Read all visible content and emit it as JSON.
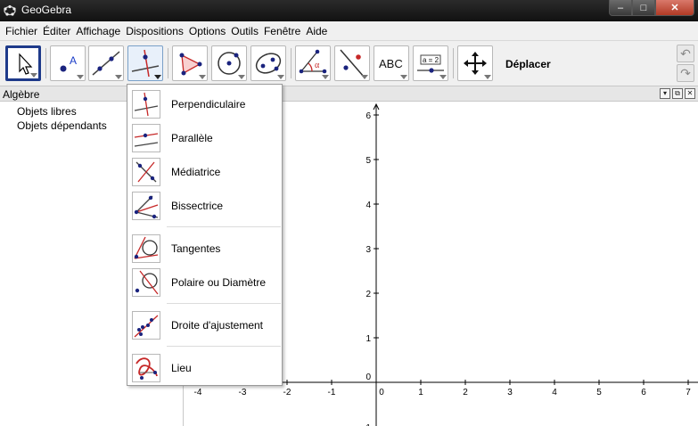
{
  "window": {
    "title": "GeoGebra",
    "min_glyph": "–",
    "max_glyph": "□",
    "close_glyph": "✕"
  },
  "menu": [
    "Fichier",
    "Éditer",
    "Affichage",
    "Dispositions",
    "Options",
    "Outils",
    "Fenêtre",
    "Aide"
  ],
  "toolbar": {
    "tools": [
      {
        "name": "move-tool-button",
        "icon": "pointer-icon"
      },
      {
        "name": "point-tool-button",
        "icon": "point-icon"
      },
      {
        "name": "line-tool-button",
        "icon": "line-icon"
      },
      {
        "name": "perpendicular-tool-button",
        "icon": "perpendicular-icon"
      },
      {
        "name": "polygon-tool-button",
        "icon": "polygon-icon"
      },
      {
        "name": "circle-tool-button",
        "icon": "circle-icon"
      },
      {
        "name": "ellipse-tool-button",
        "icon": "ellipse-icon"
      },
      {
        "name": "angle-tool-button",
        "icon": "angle-icon"
      },
      {
        "name": "reflect-tool-button",
        "icon": "reflect-icon"
      },
      {
        "name": "text-tool-button",
        "icon": "text-icon",
        "text": "ABC"
      },
      {
        "name": "slider-tool-button",
        "icon": "slider-icon",
        "text": "a = 2"
      },
      {
        "name": "move-view-tool-button",
        "icon": "move-view-icon"
      }
    ],
    "selected_tool_name": "Déplacer",
    "undo_glyph": "↶",
    "redo_glyph": "↷"
  },
  "algebra": {
    "header": "Algèbre",
    "items": [
      "Objets libres",
      "Objets dépendants"
    ]
  },
  "graphics": {
    "btn_menu": "▾",
    "btn_restore": "⧉",
    "btn_close": "✕",
    "x_ticks": [
      "-4",
      "-3",
      "-2",
      "-1",
      "0",
      "1",
      "2",
      "3",
      "4",
      "5",
      "6",
      "7"
    ],
    "y_ticks": [
      "1",
      "2",
      "3",
      "4",
      "5",
      "6"
    ],
    "y_zero": "0",
    "y_neg": "-1"
  },
  "dropdown": {
    "items": [
      {
        "label": "Perpendiculaire",
        "icon": "perpendicular-icon"
      },
      {
        "label": "Parallèle",
        "icon": "parallel-icon"
      },
      {
        "label": "Médiatrice",
        "icon": "perpendicular-bisector-icon"
      },
      {
        "label": "Bissectrice",
        "icon": "angle-bisector-icon"
      },
      {
        "label": "Tangentes",
        "icon": "tangent-icon"
      },
      {
        "label": "Polaire ou Diamètre",
        "icon": "polar-icon"
      },
      {
        "label": "Droite d'ajustement",
        "icon": "best-fit-line-icon"
      },
      {
        "label": "Lieu",
        "icon": "locus-icon"
      }
    ]
  },
  "colors": {
    "point": "#1a237e",
    "line": "#c62828",
    "selected_border": "#1e3a8a"
  }
}
